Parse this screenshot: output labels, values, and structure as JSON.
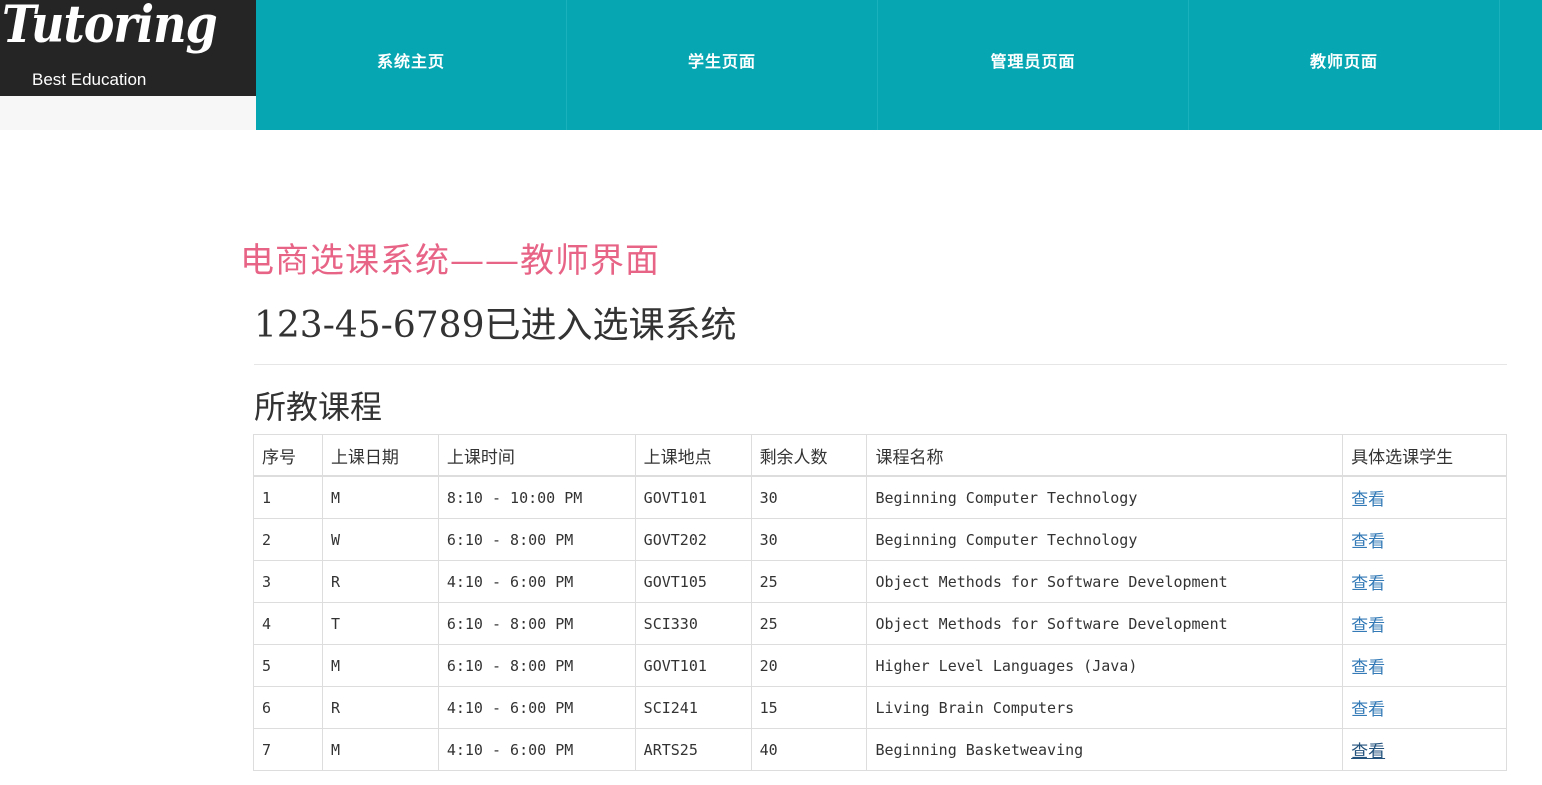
{
  "brand": {
    "script": "Tutoring",
    "tagline": "Best Education"
  },
  "nav": {
    "items": [
      "系统主页",
      "学生页面",
      "管理员页面",
      "教师页面"
    ],
    "color": "#06a7b3"
  },
  "page": {
    "system_title": "电商选课系统——教师界面",
    "welcome": "123-45-6789已进入选课系统",
    "section_title": "所教课程",
    "title_color": "#e86487"
  },
  "table": {
    "headers": [
      "序号",
      "上课日期",
      "上课时间",
      "上课地点",
      "剩余人数",
      "课程名称",
      "具体选课学生"
    ],
    "rows": [
      [
        "1",
        "M",
        "8:10 - 10:00 PM",
        "GOVT101",
        "30",
        "Beginning Computer Technology",
        "查看"
      ],
      [
        "2",
        "W",
        "6:10 - 8:00 PM",
        "GOVT202",
        "30",
        "Beginning Computer Technology",
        "查看"
      ],
      [
        "3",
        "R",
        "4:10 - 6:00 PM",
        "GOVT105",
        "25",
        "Object Methods for Software Development",
        "查看"
      ],
      [
        "4",
        "T",
        "6:10 - 8:00 PM",
        "SCI330",
        "25",
        "Object Methods for Software Development",
        "查看"
      ],
      [
        "5",
        "M",
        "6:10 - 8:00 PM",
        "GOVT101",
        "20",
        "Higher Level Languages (Java)",
        "查看"
      ],
      [
        "6",
        "R",
        "4:10 - 6:00 PM",
        "SCI241",
        "15",
        "Living Brain Computers",
        "查看"
      ],
      [
        "7",
        "M",
        "4:10 - 6:00 PM",
        "ARTS25",
        "40",
        "Beginning Basketweaving",
        "查看"
      ]
    ],
    "link_color": "#337ab7"
  }
}
